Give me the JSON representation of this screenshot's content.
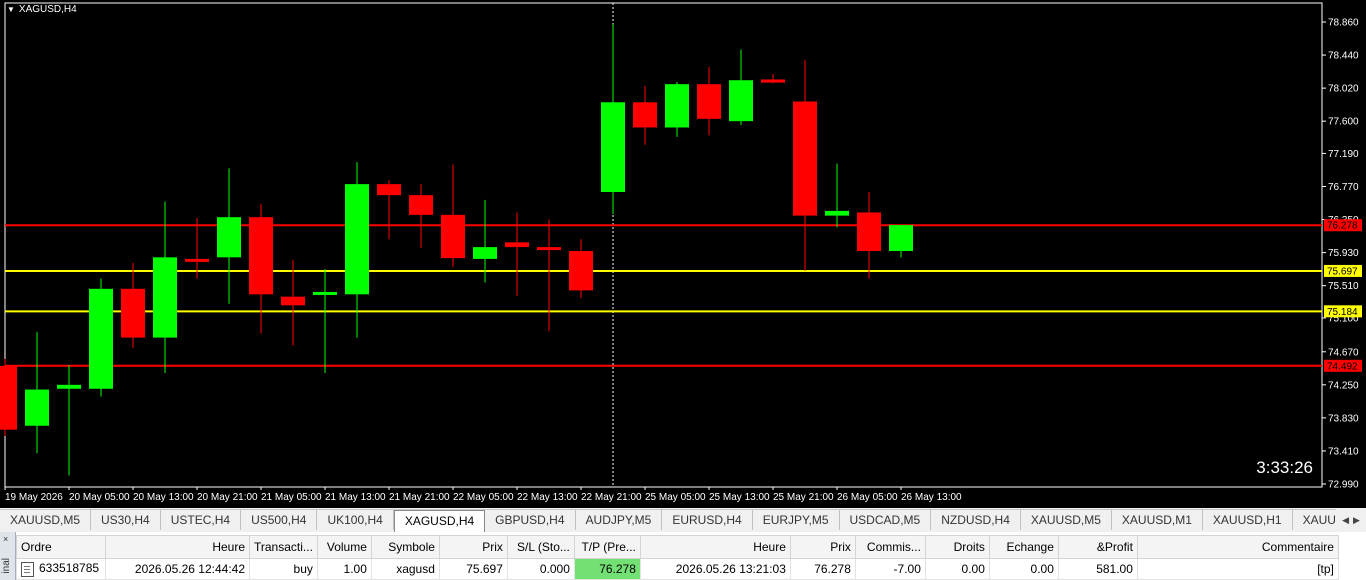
{
  "chart": {
    "title": "XAGUSD,H4",
    "countdown": "3:33:26",
    "colors": {
      "bull": "#00ff00",
      "bear": "#ff0000",
      "background": "#000000",
      "foreground": "#ffffff"
    },
    "price_axis": {
      "ticks": [
        "78.860",
        "78.440",
        "78.020",
        "77.600",
        "77.190",
        "76.770",
        "76.350",
        "75.930",
        "75.510",
        "75.100",
        "74.670",
        "74.250",
        "73.830",
        "73.410",
        "72.990"
      ],
      "min": 72.99,
      "max": 78.86
    },
    "time_axis": [
      "19 May 2026",
      "20 May 05:00",
      "20 May 13:00",
      "20 May 21:00",
      "21 May 05:00",
      "21 May 13:00",
      "21 May 21:00",
      "22 May 05:00",
      "22 May 13:00",
      "22 May 21:00",
      "25 May 05:00",
      "25 May 13:00",
      "25 May 21:00",
      "26 May 05:00",
      "26 May 13:00"
    ],
    "levels": [
      {
        "price": 76.278,
        "label": "76.278",
        "color": "#ff0000"
      },
      {
        "price": 75.697,
        "label": "75.697",
        "color": "#ffff00"
      },
      {
        "price": 75.184,
        "label": "75.184",
        "color": "#ffff00"
      },
      {
        "price": 74.492,
        "label": "74.492",
        "color": "#ff0000"
      }
    ]
  },
  "chart_data": {
    "type": "candlestick",
    "title": "XAGUSD,H4",
    "xlabel": "",
    "ylabel": "",
    "ylim": [
      72.99,
      78.86
    ],
    "candles": [
      {
        "o": 74.49,
        "h": 74.58,
        "l": 73.6,
        "c": 73.68
      },
      {
        "o": 73.73,
        "h": 74.92,
        "l": 73.38,
        "c": 74.19
      },
      {
        "o": 74.2,
        "h": 74.5,
        "l": 73.1,
        "c": 74.25
      },
      {
        "o": 74.2,
        "h": 75.6,
        "l": 74.1,
        "c": 75.47
      },
      {
        "o": 75.47,
        "h": 75.8,
        "l": 74.72,
        "c": 74.85
      },
      {
        "o": 74.85,
        "h": 76.58,
        "l": 74.4,
        "c": 75.87
      },
      {
        "o": 75.85,
        "h": 76.37,
        "l": 75.6,
        "c": 75.83
      },
      {
        "o": 75.87,
        "h": 77.0,
        "l": 75.28,
        "c": 76.38
      },
      {
        "o": 76.38,
        "h": 76.55,
        "l": 74.9,
        "c": 75.4
      },
      {
        "o": 75.37,
        "h": 75.84,
        "l": 74.75,
        "c": 75.26
      },
      {
        "o": 75.43,
        "h": 75.72,
        "l": 74.4,
        "c": 75.43
      },
      {
        "o": 75.4,
        "h": 77.08,
        "l": 74.85,
        "c": 76.8
      },
      {
        "o": 76.8,
        "h": 76.85,
        "l": 76.1,
        "c": 76.66
      },
      {
        "o": 76.66,
        "h": 76.8,
        "l": 75.99,
        "c": 76.41
      },
      {
        "o": 76.41,
        "h": 77.05,
        "l": 75.75,
        "c": 75.86
      },
      {
        "o": 75.85,
        "h": 76.6,
        "l": 75.55,
        "c": 76.0
      },
      {
        "o": 76.06,
        "h": 76.44,
        "l": 75.38,
        "c": 76.0
      },
      {
        "o": 76.0,
        "h": 76.35,
        "l": 74.93,
        "c": 75.97
      },
      {
        "o": 75.95,
        "h": 76.1,
        "l": 75.35,
        "c": 75.45
      },
      {
        "o": 76.7,
        "h": 78.83,
        "l": 76.42,
        "c": 77.84
      },
      {
        "o": 77.84,
        "h": 78.05,
        "l": 77.3,
        "c": 77.52
      },
      {
        "o": 77.52,
        "h": 78.1,
        "l": 77.4,
        "c": 78.07
      },
      {
        "o": 78.07,
        "h": 78.29,
        "l": 77.42,
        "c": 77.63
      },
      {
        "o": 77.6,
        "h": 78.51,
        "l": 77.55,
        "c": 78.12
      },
      {
        "o": 78.13,
        "h": 78.2,
        "l": 78.08,
        "c": 78.09
      },
      {
        "o": 77.85,
        "h": 78.38,
        "l": 75.7,
        "c": 76.4
      },
      {
        "o": 76.4,
        "h": 77.06,
        "l": 76.25,
        "c": 76.46
      },
      {
        "o": 76.44,
        "h": 76.7,
        "l": 75.6,
        "c": 75.95
      },
      {
        "o": 75.95,
        "h": 76.28,
        "l": 75.87,
        "c": 76.28
      }
    ]
  },
  "symbol_tabs": [
    {
      "label": "XAUUSD,M5",
      "active": false
    },
    {
      "label": "US30,H4",
      "active": false
    },
    {
      "label": "USTEC,H4",
      "active": false
    },
    {
      "label": "US500,H4",
      "active": false
    },
    {
      "label": "UK100,H4",
      "active": false
    },
    {
      "label": "XAGUSD,H4",
      "active": true
    },
    {
      "label": "GBPUSD,H4",
      "active": false
    },
    {
      "label": "AUDJPY,M5",
      "active": false
    },
    {
      "label": "EURUSD,H4",
      "active": false
    },
    {
      "label": "EURJPY,M5",
      "active": false
    },
    {
      "label": "USDCAD,M5",
      "active": false
    },
    {
      "label": "NZDUSD,H4",
      "active": false
    },
    {
      "label": "XAUUSD,M5",
      "active": false
    },
    {
      "label": "XAUUSD,M1",
      "active": false
    },
    {
      "label": "XAUUSD,H1",
      "active": false
    },
    {
      "label": "XAUUSD,Weekly",
      "active": false
    }
  ],
  "terminal": {
    "side_label": "inal",
    "close": "×",
    "columns": [
      "Ordre",
      "Heure",
      "Transacti...",
      "Volume",
      "Symbole",
      "Prix",
      "S/L (Sto...",
      "T/P (Pre...",
      "Heure",
      "Prix",
      "Commis...",
      "Droits",
      "Echange",
      "&Profit",
      "Commentaire"
    ],
    "rows": [
      [
        "633518785",
        "2026.05.26 12:44:42",
        "buy",
        "1.00",
        "xagusd",
        "75.697",
        "0.000",
        "76.278",
        "2026.05.26 13:21:03",
        "76.278",
        "-7.00",
        "0.00",
        "0.00",
        "581.00",
        "[tp]"
      ]
    ]
  }
}
